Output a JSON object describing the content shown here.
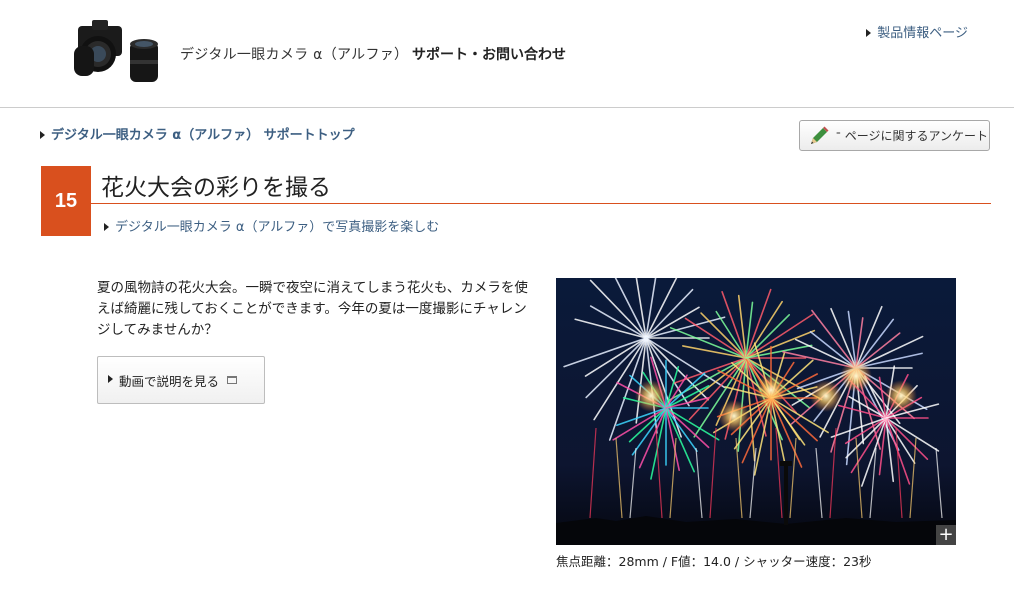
{
  "header": {
    "brand_title": "デジタル一眼カメラ α（アルファ）",
    "support_title": "サポート・お問い合わせ",
    "product_link": "製品情報ページ"
  },
  "breadcrumb": {
    "top_link": "デジタル一眼カメラ α（アルファ） サポートトップ"
  },
  "survey": {
    "label": "ページに関するアンケート"
  },
  "article": {
    "number": "15",
    "title": "花火大会の彩りを撮る",
    "parent_link": "デジタル一眼カメラ α（アルファ）で写真撮影を楽しむ",
    "intro": "夏の風物詩の花火大会。一瞬で夜空に消えてしまう花火も、カメラを使えば綺麗に残しておくことができます。今年の夏は一度撮影にチャレンジしてみませんか？",
    "video_button": "動画で説明を見る",
    "photo_caption": "焦点距離：28mm / F値：14.0 / シャッター速度：23秒",
    "zoom_symbol": "+"
  },
  "icons": {
    "bullet": "triangle-right-icon",
    "survey": "pencil-icon",
    "video": "new-window-icon",
    "zoom": "plus-icon"
  },
  "colors": {
    "accent": "#d9501e",
    "link": "#3d5f82"
  }
}
